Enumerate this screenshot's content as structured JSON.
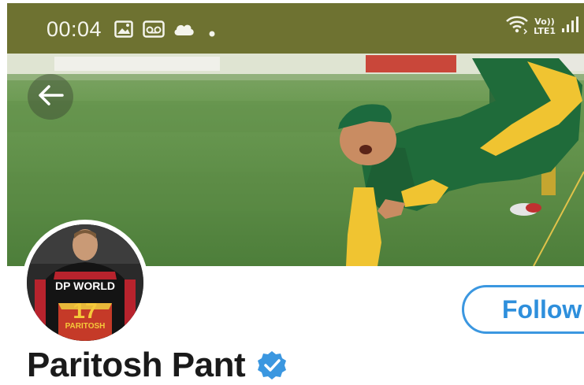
{
  "status_bar": {
    "time": "00:04",
    "icons": [
      "image-icon",
      "voicemail-icon",
      "cloud-icon",
      "dot-icon"
    ],
    "network_top": "Vo))",
    "network_bottom": "LTE1",
    "background": "#6e7231"
  },
  "header": {
    "back_icon": "arrow-left-icon",
    "banner": "cricket-fielder-diving-image"
  },
  "profile": {
    "avatar_jersey_sponsor": "DP WORLD",
    "avatar_jersey_number": "17",
    "avatar_jersey_name": "PARITOSH",
    "follow_label": "Follow",
    "display_name": "Paritosh Pant",
    "verified": true,
    "accent_color": "#3b97e0"
  }
}
